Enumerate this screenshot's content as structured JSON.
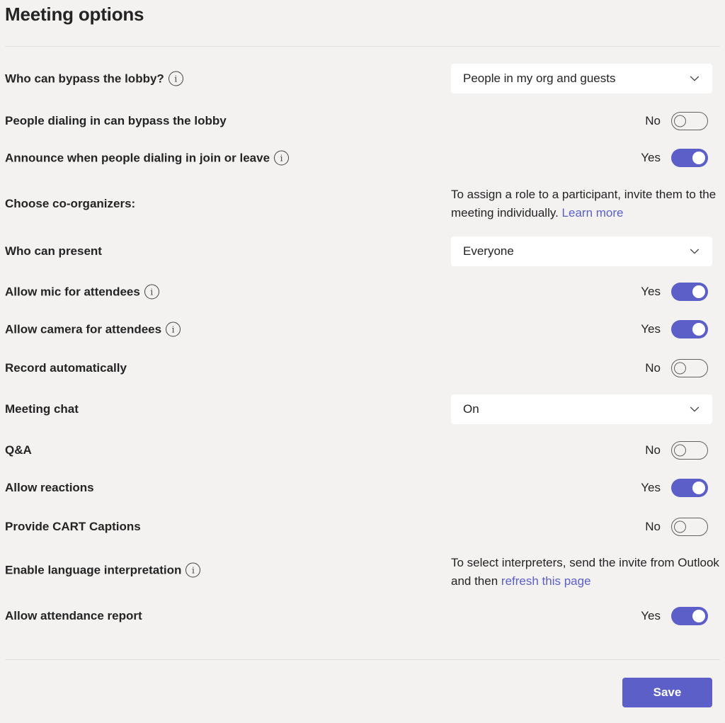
{
  "page": {
    "title": "Meeting options",
    "save_label": "Save"
  },
  "settings": [
    {
      "id": "bypass-lobby",
      "label": "Who can bypass the lobby?",
      "info": true,
      "control": "dropdown",
      "value": "People in my org and guests"
    },
    {
      "id": "dialin-bypass",
      "label": "People dialing in can bypass the lobby",
      "info": false,
      "control": "toggle",
      "on": false,
      "state_text": "No"
    },
    {
      "id": "announce-dialin",
      "label": "Announce when people dialing in join or leave",
      "info": true,
      "control": "toggle",
      "on": true,
      "state_text": "Yes"
    },
    {
      "id": "co-organizers",
      "label": "Choose co-organizers:",
      "info": false,
      "control": "note",
      "note_text": "To assign a role to a participant, invite them to the meeting individually. ",
      "link_text": "Learn more"
    },
    {
      "id": "who-present",
      "label": "Who can present",
      "info": false,
      "control": "dropdown",
      "value": "Everyone"
    },
    {
      "id": "allow-mic",
      "label": "Allow mic for attendees",
      "info": true,
      "control": "toggle",
      "on": true,
      "state_text": "Yes"
    },
    {
      "id": "allow-camera",
      "label": "Allow camera for attendees",
      "info": true,
      "control": "toggle",
      "on": true,
      "state_text": "Yes"
    },
    {
      "id": "record-auto",
      "label": "Record automatically",
      "info": false,
      "control": "toggle",
      "on": false,
      "state_text": "No"
    },
    {
      "id": "meeting-chat",
      "label": "Meeting chat",
      "info": false,
      "control": "dropdown",
      "value": "On"
    },
    {
      "id": "qa",
      "label": "Q&A",
      "info": false,
      "control": "toggle",
      "on": false,
      "state_text": "No"
    },
    {
      "id": "allow-reactions",
      "label": "Allow reactions",
      "info": false,
      "control": "toggle",
      "on": true,
      "state_text": "Yes"
    },
    {
      "id": "cart-captions",
      "label": "Provide CART Captions",
      "info": false,
      "control": "toggle",
      "on": false,
      "state_text": "No"
    },
    {
      "id": "language-interpretation",
      "label": "Enable language interpretation",
      "info": true,
      "control": "note",
      "note_text": "To select interpreters, send the invite from Outlook and then ",
      "link_text": "refresh this page"
    },
    {
      "id": "attendance-report",
      "label": "Allow attendance report",
      "info": false,
      "control": "toggle",
      "on": true,
      "state_text": "Yes"
    }
  ],
  "icons": {
    "info": "info-icon",
    "dropdown": "chevron-down-icon"
  },
  "colors": {
    "accent": "#5b5fc7",
    "background": "#f3f2f1",
    "text": "#242424"
  }
}
